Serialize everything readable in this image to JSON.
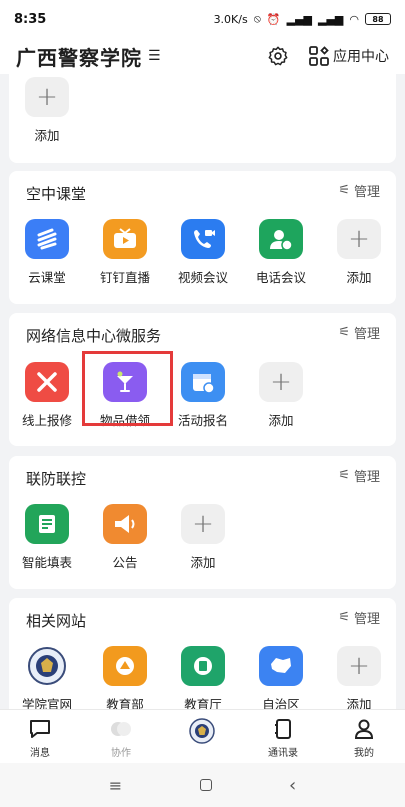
{
  "status": {
    "time": "8:35",
    "speed": "3.0K/s",
    "battery": "88"
  },
  "header": {
    "title": "广西警察学院",
    "switch_icon": "switch-icon",
    "app_center": "应用中心"
  },
  "top_partial": {
    "add_label": "添加"
  },
  "sections": {
    "classroom": {
      "title": "空中课堂",
      "manage": "管理",
      "items": [
        {
          "label": "云课堂",
          "color": "#3b7ef6"
        },
        {
          "label": "钉钉直播",
          "color": "#f39b21"
        },
        {
          "label": "视频会议",
          "color": "#2b7cf0"
        },
        {
          "label": "电话会议",
          "color": "#1ea55d"
        },
        {
          "label": "添加"
        }
      ]
    },
    "network": {
      "title": "网络信息中心微服务",
      "manage": "管理",
      "items": [
        {
          "label": "线上报修",
          "color": "#ef4c44"
        },
        {
          "label": "物品借领",
          "color": "#8a5cf0"
        },
        {
          "label": "活动报名",
          "color": "#3d8ff2"
        },
        {
          "label": "添加"
        }
      ]
    },
    "defense": {
      "title": "联防联控",
      "manage": "管理",
      "items": [
        {
          "label": "智能填表",
          "color": "#22a55a"
        },
        {
          "label": "公告",
          "color": "#f08a30"
        },
        {
          "label": "添加"
        }
      ]
    },
    "sites": {
      "title": "相关网站",
      "manage": "管理",
      "items": [
        {
          "label": "学院官网"
        },
        {
          "label": "教育部",
          "color": "#f29a1e"
        },
        {
          "label": "教育厅",
          "color": "#1fa46a"
        },
        {
          "label": "自治区",
          "color": "#3c83f2"
        },
        {
          "label": "添加"
        }
      ]
    }
  },
  "bottom_nav": [
    {
      "label": "消息"
    },
    {
      "label": "协作"
    },
    {
      "label": ""
    },
    {
      "label": "通讯录"
    },
    {
      "label": "我的"
    }
  ]
}
